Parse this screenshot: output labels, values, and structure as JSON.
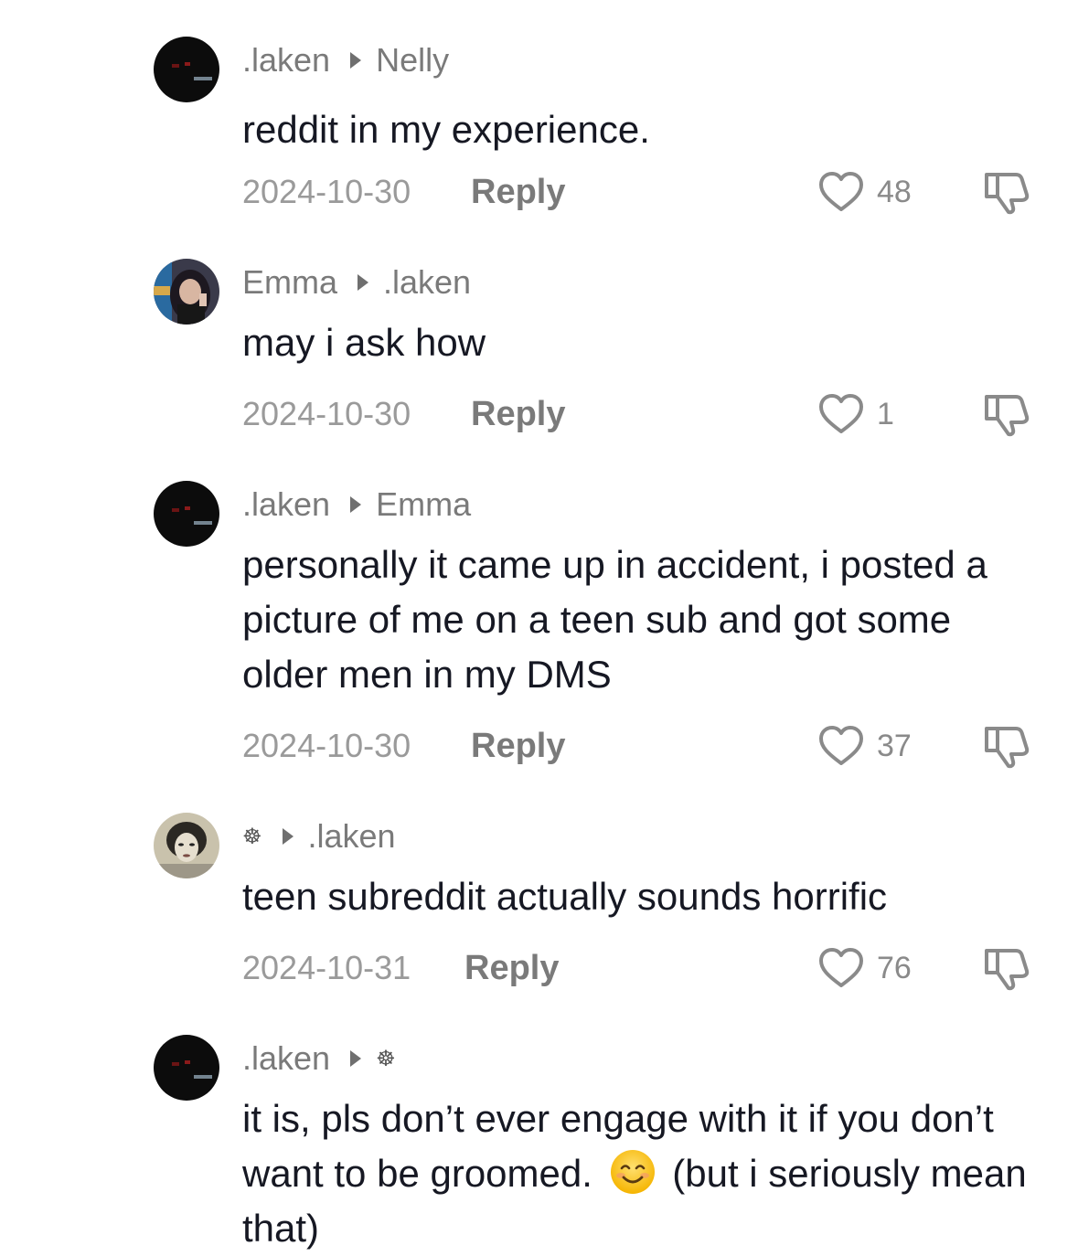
{
  "comments": [
    {
      "author": ".laken",
      "reply_to": "Nelly",
      "text": "reddit in my experience.",
      "date": "2024-10-30",
      "reply_label": "Reply",
      "likes": "48"
    },
    {
      "author": "Emma",
      "reply_to": ".laken",
      "text": "may i ask how",
      "date": "2024-10-30",
      "reply_label": "Reply",
      "likes": "1"
    },
    {
      "author": ".laken",
      "reply_to": "Emma",
      "text": "personally it came up in accident, i posted a picture of me on a teen sub and got some older men in my DMS",
      "date": "2024-10-30",
      "reply_label": "Reply",
      "likes": "37"
    },
    {
      "author": "☸",
      "reply_to": ".laken",
      "text": "teen subreddit actually sounds horrific",
      "date": "2024-10-31",
      "reply_label": "Reply",
      "likes": "76"
    },
    {
      "author": ".laken",
      "reply_to": "☸",
      "text_before_emoji": "it is, pls don’t ever engage with it if you don’t want to be groomed.",
      "emoji": "smiling-face-emoji",
      "text_after_emoji": "(but i seriously mean that)"
    }
  ],
  "icons": {
    "like": "heart-outline-icon",
    "dislike": "thumbs-down-icon",
    "arrow": "reply-arrow-icon"
  }
}
